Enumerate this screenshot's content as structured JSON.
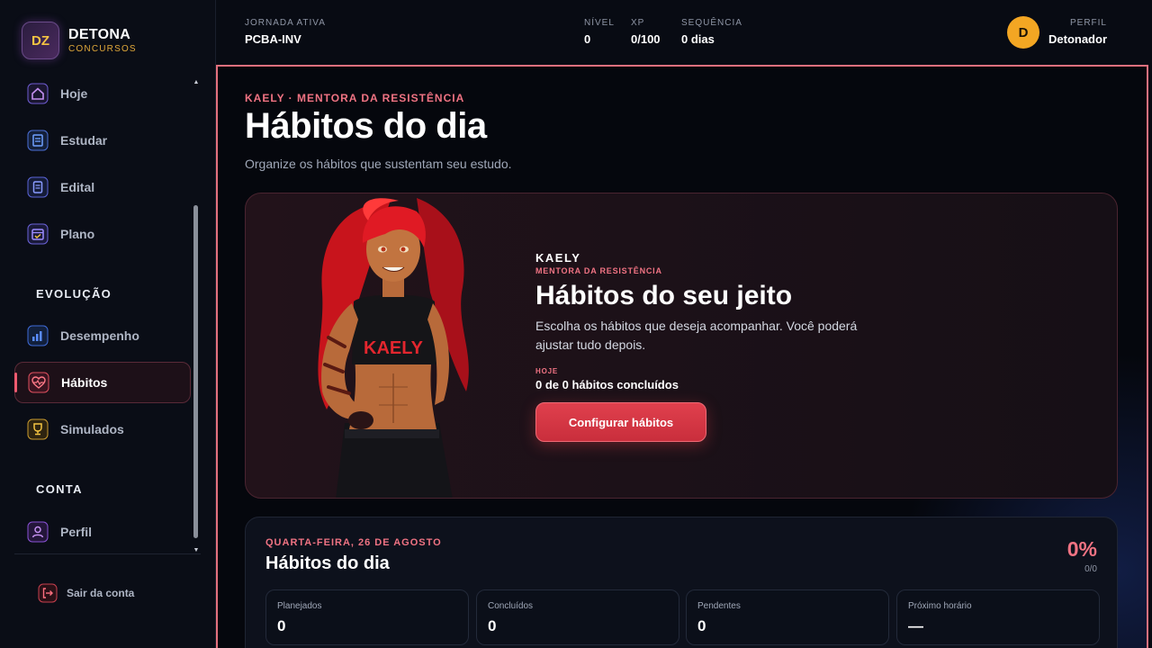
{
  "brand": {
    "name": "DETONA",
    "sub": "CONCURSOS",
    "logo_text": "DZ"
  },
  "sidebar": {
    "items_top": [
      {
        "label": "Hoje",
        "icon": "home-icon"
      },
      {
        "label": "Estudar",
        "icon": "book-icon"
      },
      {
        "label": "Edital",
        "icon": "clipboard-icon"
      },
      {
        "label": "Plano",
        "icon": "calendar-icon"
      }
    ],
    "section_evolucao": "EVOLUÇÃO",
    "items_evolucao": [
      {
        "label": "Desempenho",
        "icon": "bar-chart-icon"
      },
      {
        "label": "Hábitos",
        "icon": "heart-pulse-icon"
      },
      {
        "label": "Simulados",
        "icon": "trophy-icon"
      }
    ],
    "section_conta": "CONTA",
    "items_conta": [
      {
        "label": "Perfil",
        "icon": "user-icon"
      }
    ],
    "logout": "Sair da conta"
  },
  "header": {
    "jornada_k": "JORNADA ATIVA",
    "jornada_v": "PCBA-INV",
    "nivel_k": "NÍVEL",
    "nivel_v": "0",
    "xp_k": "XP",
    "xp_v": "0/100",
    "seq_k": "SEQUÊNCIA",
    "seq_v": "0 dias",
    "avatar": "D",
    "perfil_k": "PERFIL",
    "perfil_v": "Detonador"
  },
  "page": {
    "kicker": "KAELY · MENTORA DA RESISTÊNCIA",
    "title": "Hábitos do dia",
    "subtitle": "Organize os hábitos que sustentam seu estudo."
  },
  "hero": {
    "shirt_text": "KAELY",
    "name": "KAELY",
    "role": "MENTORA DA RESISTÊNCIA",
    "title": "Hábitos do seu jeito",
    "desc": "Escolha os hábitos que deseja acompanhar. Você poderá ajustar tudo depois.",
    "today_k": "HOJE",
    "today_v": "0 de 0 hábitos concluídos",
    "button": "Configurar hábitos"
  },
  "day": {
    "kicker": "QUARTA-FEIRA, 26 DE AGOSTO",
    "title": "Hábitos do dia",
    "pct": "0%",
    "ratio": "0/0",
    "stats": [
      {
        "k": "Planejados",
        "v": "0"
      },
      {
        "k": "Concluídos",
        "v": "0"
      },
      {
        "k": "Pendentes",
        "v": "0"
      },
      {
        "k": "Próximo horário",
        "v": "—"
      }
    ]
  },
  "colors": {
    "accent": "#f07383",
    "button": "#d9394a",
    "avatar": "#f3a623",
    "frame": "#e4707e"
  }
}
